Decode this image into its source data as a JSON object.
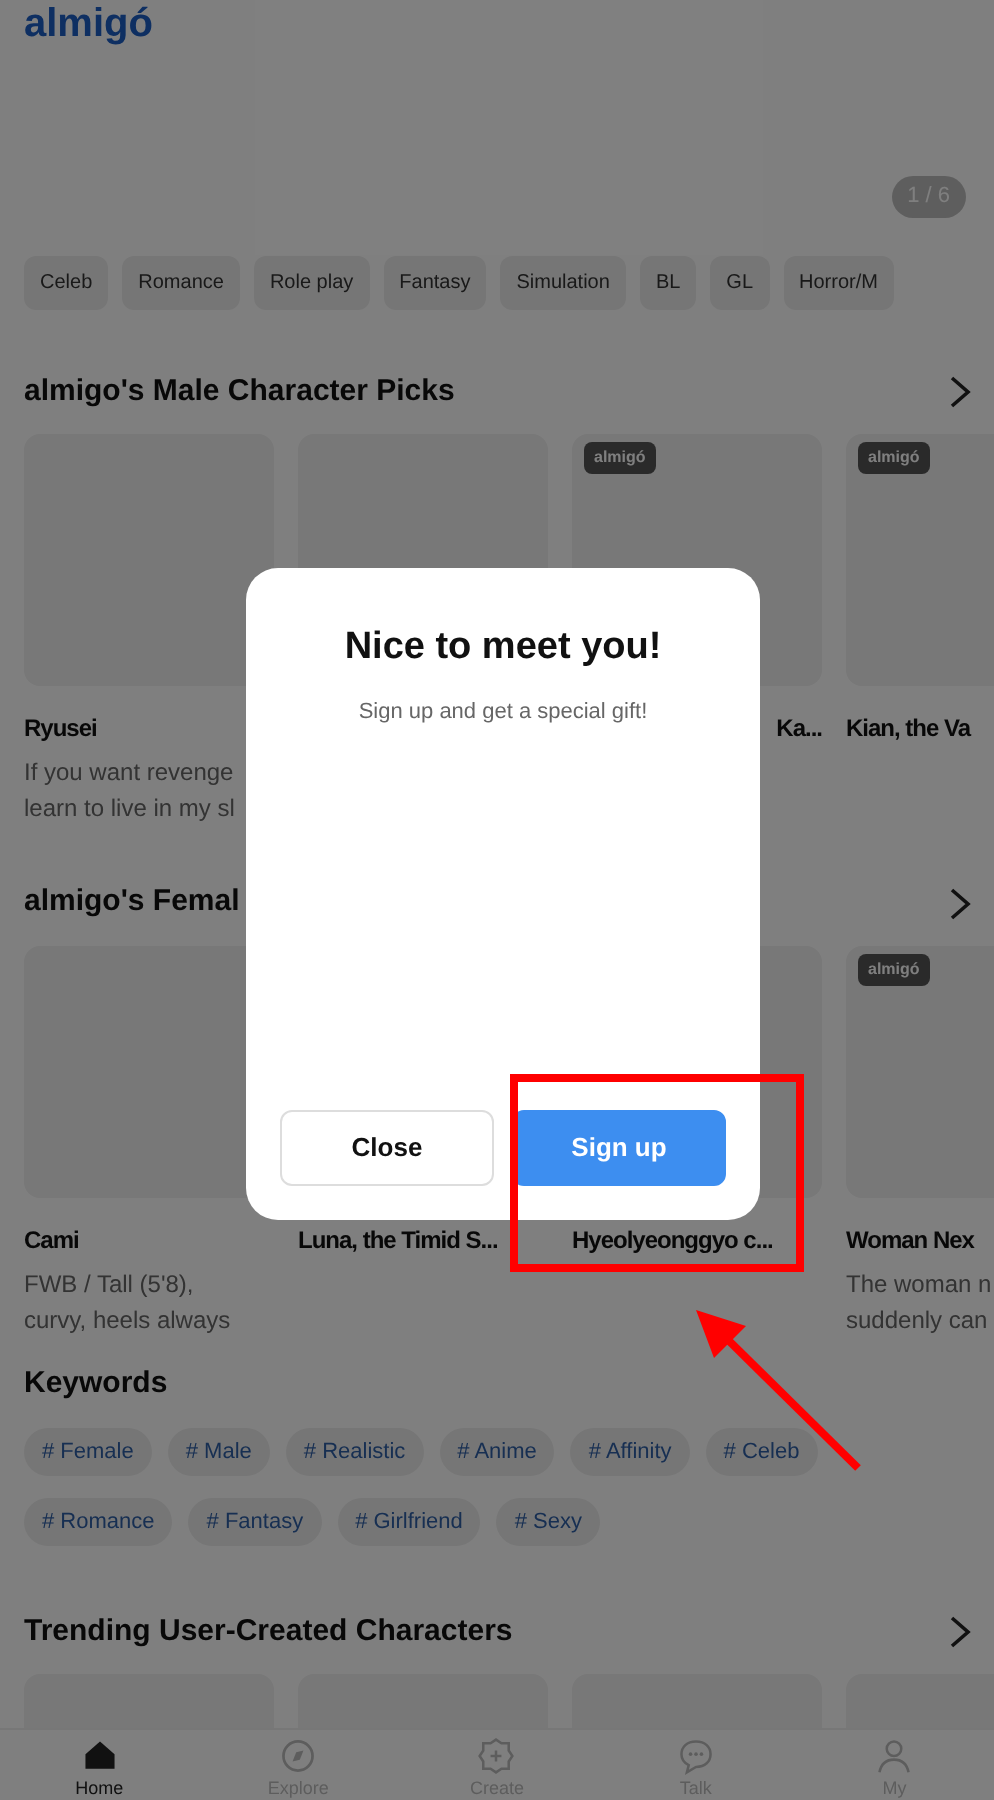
{
  "header": {
    "logo": "almigó",
    "banner_counter": "1 / 6"
  },
  "categories": [
    "Celeb",
    "Romance",
    "Role play",
    "Fantasy",
    "Simulation",
    "BL",
    "GL",
    "Horror/M"
  ],
  "sections": [
    {
      "title": "almigo's Male Character Picks",
      "cards": [
        {
          "name": "Ryusei",
          "description": [
            "If you want revenge",
            "learn to live in my sl"
          ]
        },
        {
          "kind": "image_only"
        },
        {
          "badge": "almigó",
          "name": "Ka...",
          "kind": "covered"
        },
        {
          "badge": "almigó",
          "name": "Kian, the Va"
        }
      ]
    },
    {
      "title": "almigo's Femal",
      "cards": [
        {
          "name": "Cami",
          "description": [
            "FWB / Tall (5'8),",
            "curvy, heels always"
          ]
        },
        {
          "name": "Luna, the Timid S...",
          "kind": "image_hidden"
        },
        {
          "name": "Hyeolyeonggyo c..."
        },
        {
          "badge": "almigó",
          "name": "Woman Nex",
          "description": [
            "The woman n",
            "suddenly can"
          ]
        }
      ]
    }
  ],
  "keywords": {
    "title": "Keywords",
    "tags": [
      "# Female",
      "# Male",
      "# Realistic",
      "# Anime",
      "# Affinity",
      "# Celeb",
      "# Romance",
      "# Fantasy",
      "# Girlfriend",
      "# Sexy"
    ]
  },
  "trending": {
    "title": "Trending User-Created Characters"
  },
  "bottom_nav": [
    {
      "label": "Home",
      "selected": true
    },
    {
      "label": "Explore",
      "selected": false
    },
    {
      "label": "Create",
      "selected": false
    },
    {
      "label": "Talk",
      "selected": false
    },
    {
      "label": "My",
      "selected": false
    }
  ],
  "dialog": {
    "title": "Nice to meet you!",
    "message": "Sign up and get a special gift!",
    "buttons": [
      {
        "label": "Close",
        "kind": "secondary"
      },
      {
        "label": "Sign up",
        "kind": "primary"
      }
    ]
  }
}
